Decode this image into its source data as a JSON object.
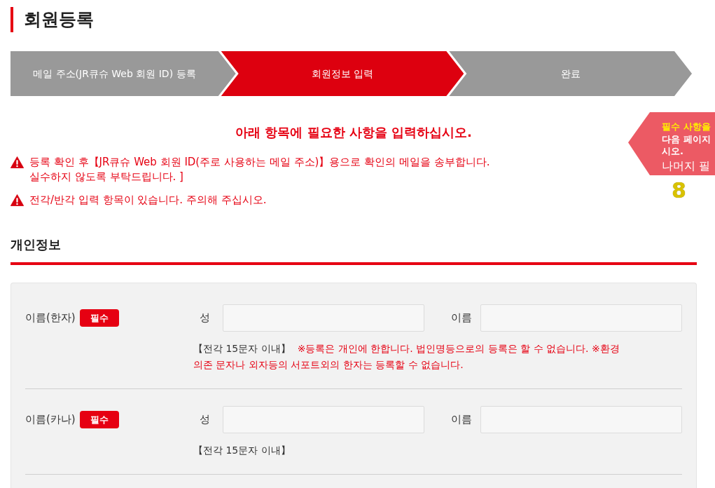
{
  "page_title": "회원등록",
  "steps": [
    {
      "label": "메일 주소(JR큐슈 Web 회원 ID) 등록",
      "selected": false
    },
    {
      "label": "회원정보 입력",
      "selected": true
    },
    {
      "label": "완료",
      "selected": false
    }
  ],
  "instruction": "아래 항목에 필요한 사항을 입력하십시오.",
  "warnings": [
    {
      "lines": [
        "등록 확인 후【JR큐슈 Web 회원 ID(주로 사용하는 메일 주소)】용으로 확인의 메일을 송부합니다.",
        "실수하지 않도록 부탁드립니다. ]"
      ]
    },
    {
      "lines": [
        "전각/반각 입력 항목이 있습니다. 주의해 주십시오."
      ]
    }
  ],
  "required_notice": {
    "highlight": "필수 사항을",
    "lines": [
      "다음 페이지",
      "시오."
    ],
    "remaining_label": "나머지 필",
    "remaining_count": "8"
  },
  "section": {
    "title": "개인정보",
    "fields": [
      {
        "label": "이름(한자)",
        "badge": "필수",
        "inputs": [
          {
            "label": "성"
          },
          {
            "label": "이름"
          }
        ],
        "hint": "【전각 15문자 이내】",
        "warning_lines": [
          "※등록은 개인에 한합니다. 법인명등으로의 등록은 할 수 없습니다. ※환경",
          "의존 문자나 외자등의 서포트외의 한자는 등록할 수 없습니다."
        ]
      },
      {
        "label": "이름(카나)",
        "badge": "필수",
        "inputs": [
          {
            "label": "성"
          },
          {
            "label": "이름"
          }
        ],
        "hint": "【전각 15문자 이내】"
      }
    ]
  }
}
